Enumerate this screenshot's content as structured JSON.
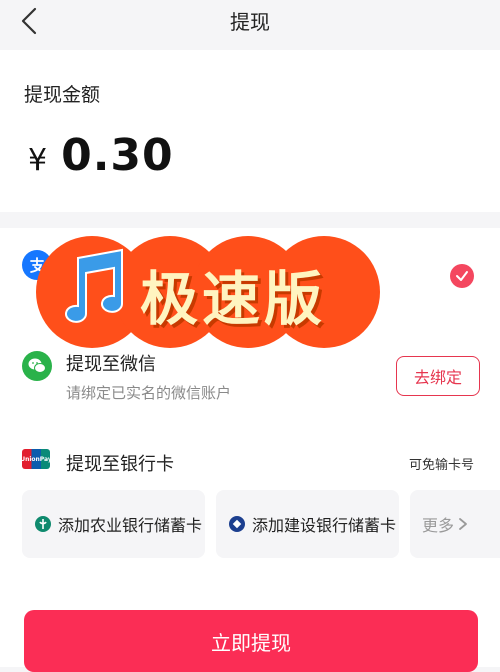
{
  "header": {
    "title": "提现"
  },
  "amount": {
    "label": "提现金额",
    "currency": "¥",
    "value": "0.30"
  },
  "methods": {
    "alipay": {
      "icon": "alipay-icon",
      "selected": true
    },
    "wechat": {
      "icon": "wechat-icon",
      "title": "提现至微信",
      "subtitle": "请绑定已实名的微信账户",
      "bind_label": "去绑定"
    },
    "bank": {
      "icon": "unionpay-icon",
      "title": "提现至银行卡",
      "tip": "可免输卡号",
      "options": [
        {
          "icon": "abc-bank-icon",
          "label": "添加农业银行储蓄卡"
        },
        {
          "icon": "ccb-bank-icon",
          "label": "添加建设银行储蓄卡"
        }
      ],
      "more_label": "更多"
    }
  },
  "submit": {
    "label": "立即提现"
  },
  "promo": {
    "text": "极速版",
    "icon": "music-note-icon"
  },
  "colors": {
    "accent": "#fb2d55",
    "bind_border": "#e6364f",
    "check": "#f4475f",
    "wechat_green": "#2ab24a",
    "alipay_blue": "#1677ff",
    "promo_orange": "#ff4f1a"
  }
}
